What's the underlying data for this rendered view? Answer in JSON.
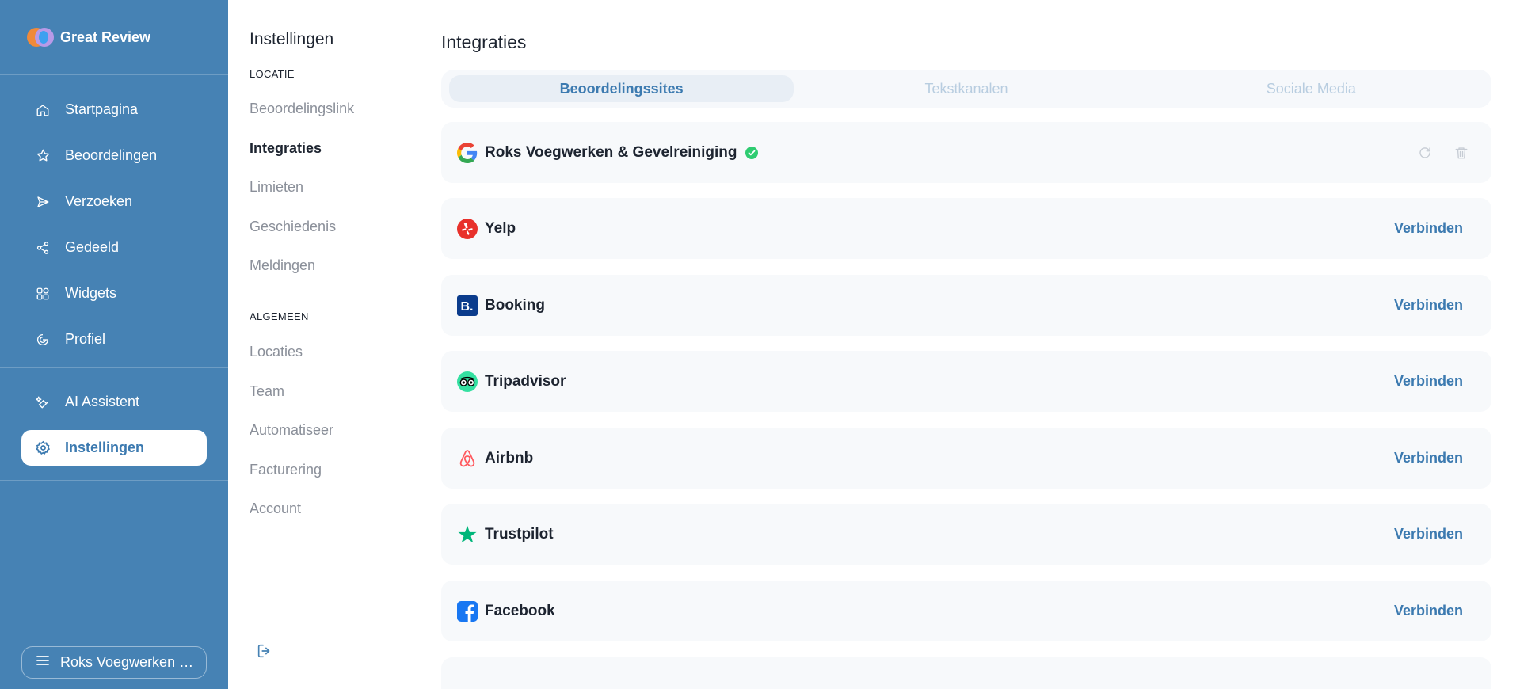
{
  "app": {
    "name": "Great Review"
  },
  "sidebar": {
    "items": [
      {
        "label": "Startpagina",
        "icon": "home-icon"
      },
      {
        "label": "Beoordelingen",
        "icon": "star-icon"
      },
      {
        "label": "Verzoeken",
        "icon": "send-icon"
      },
      {
        "label": "Gedeeld",
        "icon": "share-icon"
      },
      {
        "label": "Widgets",
        "icon": "widgets-icon"
      },
      {
        "label": "Profiel",
        "icon": "profile-icon"
      }
    ],
    "secondary": [
      {
        "label": "AI Assistent",
        "icon": "ai-sparkle-icon"
      },
      {
        "label": "Instellingen",
        "icon": "gear-icon",
        "active": true
      }
    ],
    "location_switcher": {
      "label": "Roks Voegwerken & Gevelreiniging",
      "icon": "menu-icon"
    }
  },
  "settings": {
    "title": "Instellingen",
    "section_location": "LOCATIE",
    "location_items": [
      "Beoordelingslink",
      "Integraties",
      "Limieten",
      "Geschiedenis",
      "Meldingen"
    ],
    "section_general": "ALGEMEEN",
    "general_items": [
      "Locaties",
      "Team",
      "Automatiseer",
      "Facturering",
      "Account"
    ],
    "active_item": "Integraties"
  },
  "main": {
    "title": "Integraties",
    "tabs": [
      {
        "label": "Beoordelingssites",
        "active": true
      },
      {
        "label": "Tekstkanalen",
        "active": false
      },
      {
        "label": "Sociale Media",
        "active": false
      }
    ],
    "connect_label": "Verbinden",
    "integrations": [
      {
        "name": "Roks Voegwerken & Gevelreiniging",
        "icon": "google-icon",
        "connected": true
      },
      {
        "name": "Yelp",
        "icon": "yelp-icon",
        "connected": false
      },
      {
        "name": "Booking",
        "icon": "booking-icon",
        "connected": false
      },
      {
        "name": "Tripadvisor",
        "icon": "tripadvisor-icon",
        "connected": false
      },
      {
        "name": "Airbnb",
        "icon": "airbnb-icon",
        "connected": false
      },
      {
        "name": "Trustpilot",
        "icon": "trustpilot-icon",
        "connected": false
      },
      {
        "name": "Facebook",
        "icon": "facebook-icon",
        "connected": false
      }
    ]
  },
  "colors": {
    "sidebar_bg": "#4682b4",
    "accent": "#3c7ab0",
    "verified": "#2ecc71",
    "muted_text": "#8a8f99",
    "card_bg": "#f7f9fb"
  }
}
